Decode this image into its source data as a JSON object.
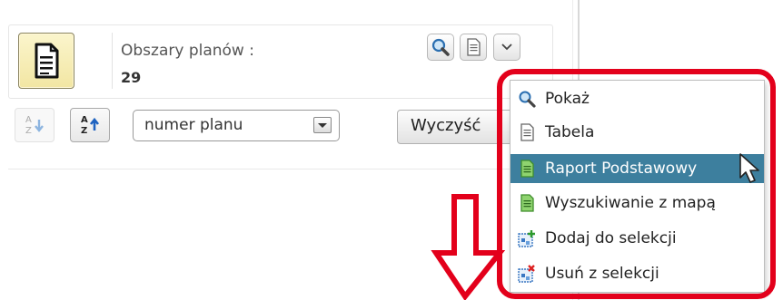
{
  "panel": {
    "title": "Obszary planów :",
    "count": "29"
  },
  "toolbar": {
    "show_icon": "magnifier-icon",
    "table_icon": "document-icon",
    "more_icon": "chevron-down-icon"
  },
  "sort": {
    "asc_icon": "sort-az-down-icon",
    "desc_icon": "sort-az-up-icon",
    "field_value": "numer planu"
  },
  "clear_button": {
    "label": "Wyczyść"
  },
  "menu": {
    "items": [
      {
        "label": "Pokaż",
        "icon": "magnifier-icon"
      },
      {
        "label": "Tabela",
        "icon": "document-icon"
      },
      {
        "label": "Raport Podstawowy",
        "icon": "green-document-icon",
        "active": true
      },
      {
        "label": "Wyszukiwanie z mapą",
        "icon": "green-document-icon"
      },
      {
        "label": "Dodaj do selekcji",
        "icon": "add-selection-icon"
      },
      {
        "label": "Usuń z selekcji",
        "icon": "remove-selection-icon"
      }
    ]
  },
  "colors": {
    "highlight": "#3d7f9e",
    "annotation_red": "#e3001b",
    "big_button_bg": "#f6eebb"
  }
}
